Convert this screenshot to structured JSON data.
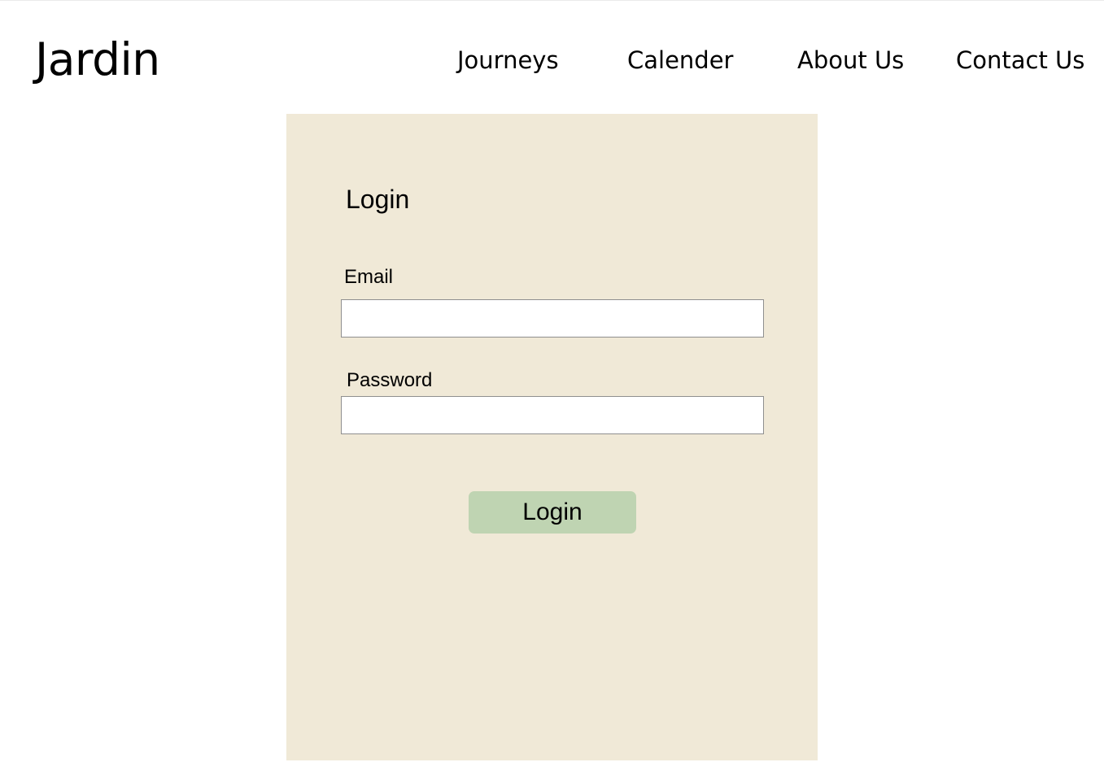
{
  "header": {
    "brand": "Jardin",
    "nav": [
      {
        "label": "Journeys"
      },
      {
        "label": "Calender"
      },
      {
        "label": "About Us"
      },
      {
        "label": "Contact Us"
      }
    ]
  },
  "login_form": {
    "title": "Login",
    "email": {
      "label": "Email",
      "value": "",
      "placeholder": ""
    },
    "password": {
      "label": "Password",
      "value": "",
      "placeholder": ""
    },
    "submit_label": "Login"
  },
  "colors": {
    "card_background": "#f0e9d7",
    "button_background": "#bfd4b2",
    "input_border": "#8f8f8f",
    "text": "#000000"
  }
}
